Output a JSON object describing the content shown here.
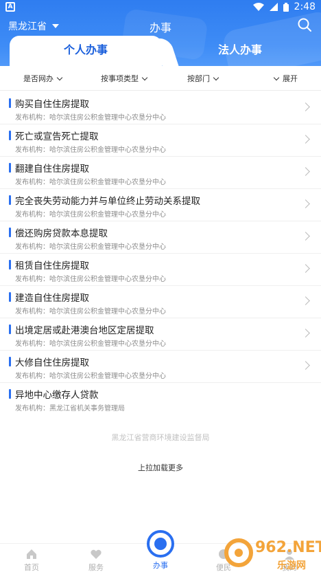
{
  "status_bar": {
    "time": "2:48"
  },
  "top_bar": {
    "region": "黑龙江省",
    "title": "办事"
  },
  "tabs": {
    "personal": "个人办事",
    "legal": "法人办事"
  },
  "filters": {
    "online": "是否网办",
    "type": "按事项类型",
    "dept": "按部门",
    "expand": "展开"
  },
  "items": [
    {
      "name": "购买自住住房提取",
      "org": "发布机构：哈尔滨住房公积金管理中心农垦分中心"
    },
    {
      "name": "死亡或宣告死亡提取",
      "org": "发布机构：哈尔滨住房公积金管理中心农垦分中心"
    },
    {
      "name": "翻建自住住房提取",
      "org": "发布机构：哈尔滨住房公积金管理中心农垦分中心"
    },
    {
      "name": "完全丧失劳动能力并与单位终止劳动关系提取",
      "org": "发布机构：哈尔滨住房公积金管理中心农垦分中心"
    },
    {
      "name": "偿还购房贷款本息提取",
      "org": "发布机构：哈尔滨住房公积金管理中心农垦分中心"
    },
    {
      "name": "租赁自住住房提取",
      "org": "发布机构：哈尔滨住房公积金管理中心农垦分中心"
    },
    {
      "name": "建造自住住房提取",
      "org": "发布机构：哈尔滨住房公积金管理中心农垦分中心"
    },
    {
      "name": "出境定居或赴港澳台地区定居提取",
      "org": "发布机构：哈尔滨住房公积金管理中心农垦分中心"
    },
    {
      "name": "大修自住住房提取",
      "org": "发布机构：哈尔滨住房公积金管理中心农垦分中心"
    },
    {
      "name": "异地中心缴存人贷款",
      "org": "发布机构：黑龙江省机关事务管理局"
    }
  ],
  "footer_note": "黑龙江省营商环境建设监督局",
  "load_more": "上拉加载更多",
  "bottom_nav": {
    "home": "首页",
    "service": "服务",
    "affairs": "办事",
    "convenience": "便民",
    "mine": "我的"
  },
  "watermark": {
    "brand": "962.NET",
    "sub": "乐游网"
  },
  "colors": {
    "primary": "#2a6ff0",
    "header": "#3e8cf6"
  }
}
